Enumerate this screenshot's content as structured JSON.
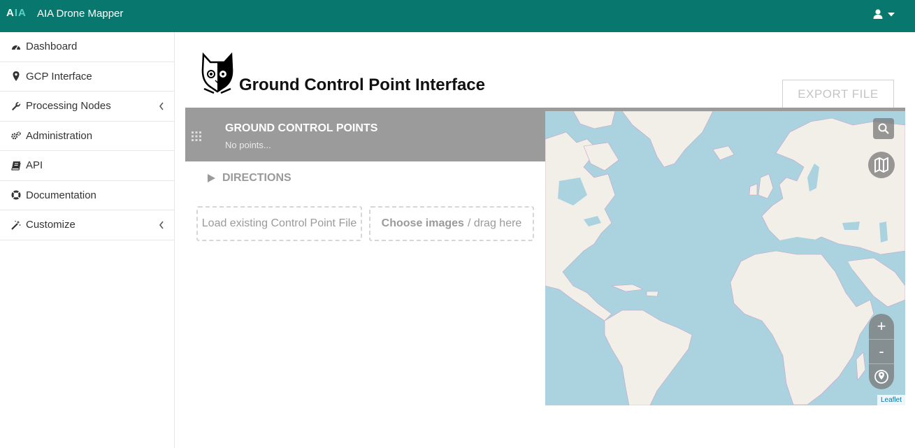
{
  "navbar": {
    "logo_text_a": "A",
    "logo_text_b": "I",
    "logo_text_c": "A",
    "title": "AIA Drone Mapper",
    "user_icon": "user-icon",
    "caret_icon": "caret-down-icon"
  },
  "sidebar": {
    "items": [
      {
        "label": "Dashboard",
        "icon": "dashboard-icon"
      },
      {
        "label": "GCP Interface",
        "icon": "map-marker-icon"
      },
      {
        "label": "Processing Nodes",
        "icon": "wrench-icon"
      },
      {
        "label": "Administration",
        "icon": "gears-icon"
      },
      {
        "label": "API",
        "icon": "book-icon"
      },
      {
        "label": "Documentation",
        "icon": "life-ring-icon"
      },
      {
        "label": "Customize",
        "icon": "magic-wand-icon"
      }
    ]
  },
  "page": {
    "title": "Ground Control Point Interface",
    "export_label": "EXPORT FILE"
  },
  "gcp_panel": {
    "title": "GROUND CONTROL POINTS",
    "subtitle": "No points..."
  },
  "directions": {
    "label": "DIRECTIONS"
  },
  "uploads": {
    "load_label": "Load existing Control Point File",
    "choose_strong": "Choose images",
    "choose_rest": "/ drag here"
  },
  "map": {
    "zoom_in": "+",
    "zoom_out": "-",
    "attribution": "Leaflet",
    "water_color": "#aad3df",
    "land_color": "#f2efe9",
    "border_color": "#c9a0c9"
  }
}
